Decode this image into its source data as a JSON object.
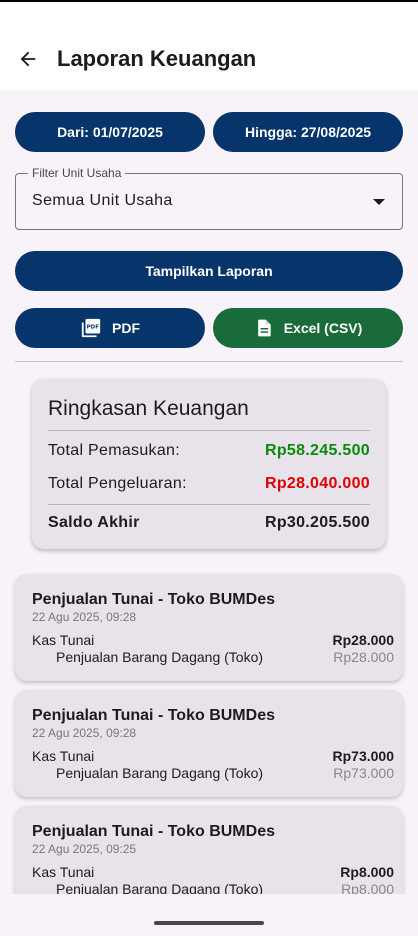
{
  "app_bar": {
    "title": "Laporan Keuangan"
  },
  "dates": {
    "from_label": "Dari: 01/07/2025",
    "to_label": "Hingga: 27/08/2025"
  },
  "filter": {
    "label": "Filter Unit Usaha",
    "value": "Semua Unit Usaha"
  },
  "actions": {
    "show_report": "Tampilkan Laporan",
    "pdf": "PDF",
    "excel": "Excel (CSV)"
  },
  "summary": {
    "title": "Ringkasan Keuangan",
    "income_label": "Total Pemasukan:",
    "income_value": "Rp58.245.500",
    "expense_label": "Total Pengeluaran:",
    "expense_value": "Rp28.040.000",
    "balance_label": "Saldo Akhir",
    "balance_value": "Rp30.205.500"
  },
  "colors": {
    "primary": "#06346b",
    "excel": "#1a6b3a",
    "income": "#0a8a0a",
    "expense": "#e00000"
  },
  "transactions": [
    {
      "title": "Penjualan Tunai - Toko BUMDes",
      "date": "22 Agu 2025, 09:28",
      "account": "Kas Tunai",
      "amount": "Rp28.000",
      "sub_account": "Penjualan Barang Dagang (Toko)",
      "sub_amount": "Rp28.000"
    },
    {
      "title": "Penjualan Tunai - Toko BUMDes",
      "date": "22 Agu 2025, 09:28",
      "account": "Kas Tunai",
      "amount": "Rp73.000",
      "sub_account": "Penjualan Barang Dagang (Toko)",
      "sub_amount": "Rp73.000"
    },
    {
      "title": "Penjualan Tunai - Toko BUMDes",
      "date": "22 Agu 2025, 09:25",
      "account": "Kas Tunai",
      "amount": "Rp8.000",
      "sub_account": "Penjualan Barang Dagang (Toko)",
      "sub_amount": "Rp8.000"
    }
  ]
}
